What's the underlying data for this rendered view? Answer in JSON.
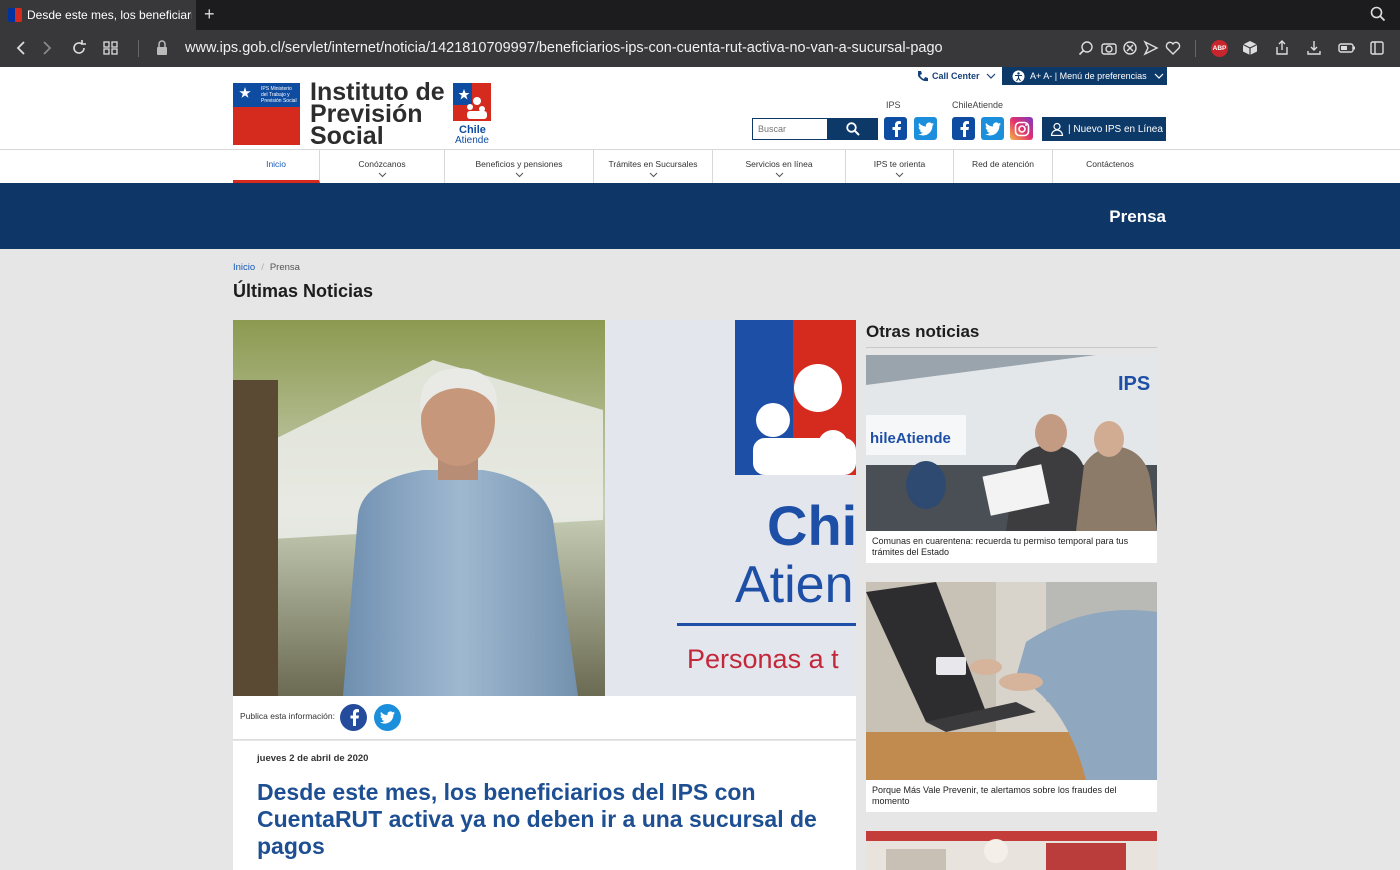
{
  "browser": {
    "tab_title": "Desde este mes, los beneficiarios",
    "new_tab": "+",
    "url": "www.ips.gob.cl/servlet/internet/noticia/1421810709997/beneficiarios-ips-con-cuenta-rut-activa-no-van-a-sucursal-pago",
    "adblock_label": "ABP"
  },
  "header": {
    "logo_mini": "IPS Ministerio del Trabajo y Previsión Social",
    "logo_line1": "Instituto de",
    "logo_line2": "Previsión",
    "logo_line3": "Social",
    "chile_line1": "Chile",
    "chile_line2": "Atiende",
    "call_center": "Call Center",
    "preferences": "A+ A- | Menú de preferencias",
    "label_ips": "IPS",
    "label_chileatiende": "ChileAtiende",
    "search_placeholder": "Buscar",
    "nuevo_ips": "| Nuevo IPS en Línea"
  },
  "nav": {
    "items": [
      "Inicio",
      "Conózcanos",
      "Beneficios y pensiones",
      "Trámites en Sucursales",
      "Servicios en línea",
      "IPS te orienta",
      "Red de atención",
      "Contáctenos"
    ]
  },
  "band": {
    "title": "Prensa"
  },
  "breadcrumb": {
    "home": "Inicio",
    "sep": "/",
    "current": "Prensa"
  },
  "main": {
    "heading": "Últimas Noticias",
    "hero_sign_line1": "Chi",
    "hero_sign_line2": "Atien",
    "hero_sign_line3": "Personas a t",
    "share_label": "Publica esta información:",
    "date": "jueves 2 de abril de 2020",
    "title": "Desde este mes, los beneficiarios del IPS con CuentaRUT activa ya no deben ir a una sucursal de pagos"
  },
  "sidebar": {
    "heading": "Otras noticias",
    "card1_sign": "hileAtiende",
    "card1_sign2": "IPS",
    "cards": [
      {
        "caption": "Comunas en cuarentena: recuerda tu permiso temporal para tus trámites del Estado"
      },
      {
        "caption": "Porque Más Vale Prevenir, te alertamos sobre los fraudes del momento"
      }
    ]
  },
  "colors": {
    "brand_blue": "#0e3767",
    "brand_red": "#d52b1e",
    "link_blue": "#1559b7"
  }
}
